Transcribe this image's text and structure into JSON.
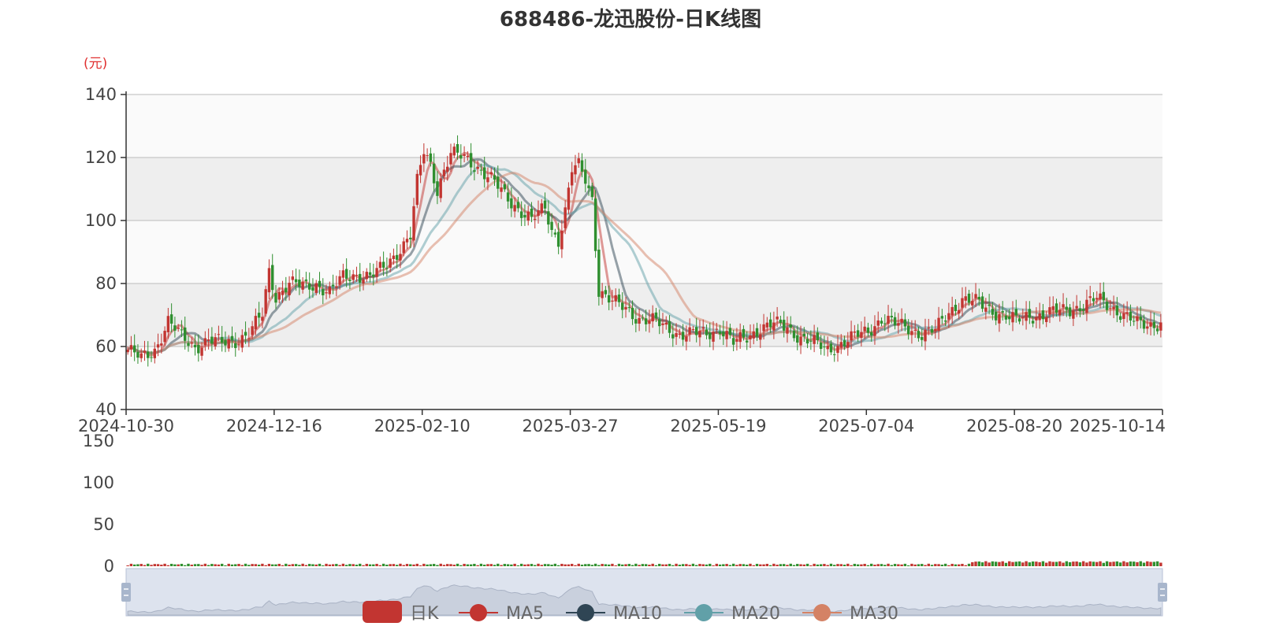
{
  "chart_data": {
    "type": "candlestick",
    "title": "688486-龙迅股份-日K线图",
    "unit_label": "(元)",
    "ylim": [
      40,
      140
    ],
    "y_ticks": [
      "140",
      "120",
      "100",
      "80",
      "60",
      "40"
    ],
    "x_ticks": [
      "2024-10-30",
      "2024-12-16",
      "2025-02-10",
      "2025-03-27",
      "2025-05-19",
      "2025-07-04",
      "2025-08-20",
      "2025-10-14"
    ],
    "volume_ylim": [
      0,
      150
    ],
    "volume_ticks": [
      "150",
      "100",
      "50",
      "0"
    ],
    "legend": [
      "日K",
      "MA5",
      "MA10",
      "MA20",
      "MA30"
    ],
    "close_path": [
      [
        0,
        59
      ],
      [
        4,
        56
      ],
      [
        8,
        59
      ],
      [
        12,
        68
      ],
      [
        16,
        63
      ],
      [
        20,
        60
      ],
      [
        24,
        62
      ],
      [
        28,
        61
      ],
      [
        32,
        62
      ],
      [
        36,
        64
      ],
      [
        40,
        70
      ],
      [
        42,
        84
      ],
      [
        44,
        76
      ],
      [
        48,
        80
      ],
      [
        52,
        79
      ],
      [
        56,
        80
      ],
      [
        60,
        77
      ],
      [
        64,
        82
      ],
      [
        68,
        83
      ],
      [
        72,
        82
      ],
      [
        76,
        85
      ],
      [
        80,
        90
      ],
      [
        84,
        95
      ],
      [
        86,
        112
      ],
      [
        88,
        122
      ],
      [
        90,
        118
      ],
      [
        92,
        110
      ],
      [
        94,
        116
      ],
      [
        96,
        121
      ],
      [
        100,
        120
      ],
      [
        104,
        117
      ],
      [
        108,
        113
      ],
      [
        112,
        108
      ],
      [
        116,
        104
      ],
      [
        120,
        100
      ],
      [
        124,
        104
      ],
      [
        126,
        97
      ],
      [
        128,
        94
      ],
      [
        130,
        103
      ],
      [
        132,
        116
      ],
      [
        134,
        117
      ],
      [
        136,
        113
      ],
      [
        138,
        107
      ],
      [
        140,
        78
      ],
      [
        144,
        74
      ],
      [
        148,
        72
      ],
      [
        152,
        69
      ],
      [
        156,
        68
      ],
      [
        160,
        66
      ],
      [
        164,
        64
      ],
      [
        168,
        64
      ],
      [
        172,
        64
      ],
      [
        176,
        66
      ],
      [
        180,
        61
      ],
      [
        184,
        63
      ],
      [
        188,
        66
      ],
      [
        192,
        67
      ],
      [
        196,
        66
      ],
      [
        200,
        63
      ],
      [
        204,
        61
      ],
      [
        208,
        59
      ],
      [
        212,
        61
      ],
      [
        216,
        63
      ],
      [
        220,
        65
      ],
      [
        224,
        69
      ],
      [
        228,
        67
      ],
      [
        232,
        66
      ],
      [
        236,
        64
      ],
      [
        240,
        65
      ],
      [
        244,
        71
      ],
      [
        248,
        75
      ],
      [
        252,
        74
      ],
      [
        256,
        72
      ],
      [
        260,
        70
      ],
      [
        264,
        68
      ],
      [
        268,
        70
      ],
      [
        272,
        70
      ],
      [
        276,
        71
      ],
      [
        280,
        72
      ],
      [
        284,
        73
      ],
      [
        288,
        75
      ],
      [
        292,
        73
      ],
      [
        296,
        70
      ],
      [
        300,
        67
      ],
      [
        304,
        67
      ],
      [
        308,
        68
      ]
    ],
    "series": [
      {
        "name": "日K",
        "color": "#c23531"
      },
      {
        "name": "MA5",
        "color": "#c23531"
      },
      {
        "name": "MA10",
        "color": "#2f4554"
      },
      {
        "name": "MA20",
        "color": "#61a0a8"
      },
      {
        "name": "MA30",
        "color": "#d48265"
      }
    ],
    "up_color": "#c23531",
    "down_color": "#2f8f2f"
  }
}
